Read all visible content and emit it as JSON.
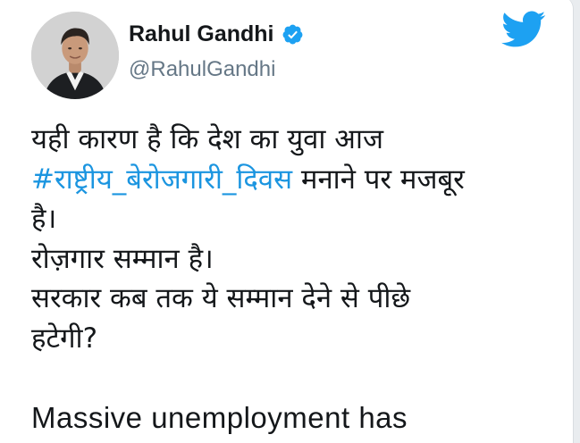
{
  "author": {
    "display_name": "Rahul Gandhi",
    "handle": "@RahulGandhi",
    "verified": true,
    "avatar_icon": "profile-photo"
  },
  "brand": {
    "icon": "twitter-bird-icon",
    "color": "#1da1f2"
  },
  "colors": {
    "text": "#14171a",
    "muted": "#657786",
    "link": "#1b95e0",
    "verified_badge": "#1da1f2"
  },
  "tweet": {
    "line1": "यही कारण है कि देश का युवा आज",
    "hashtag": "#राष्ट्रीय_बेरोजगारी_दिवस",
    "line2_rest": " मनाने पर मजबूर",
    "line3": "है।",
    "line4": "रोज़गार सम्मान है।",
    "line5": "सरकार कब तक ये सम्मान देने से पीछे",
    "line6": "हटेगी?",
    "line8_partial": "Massive unemployment has"
  }
}
